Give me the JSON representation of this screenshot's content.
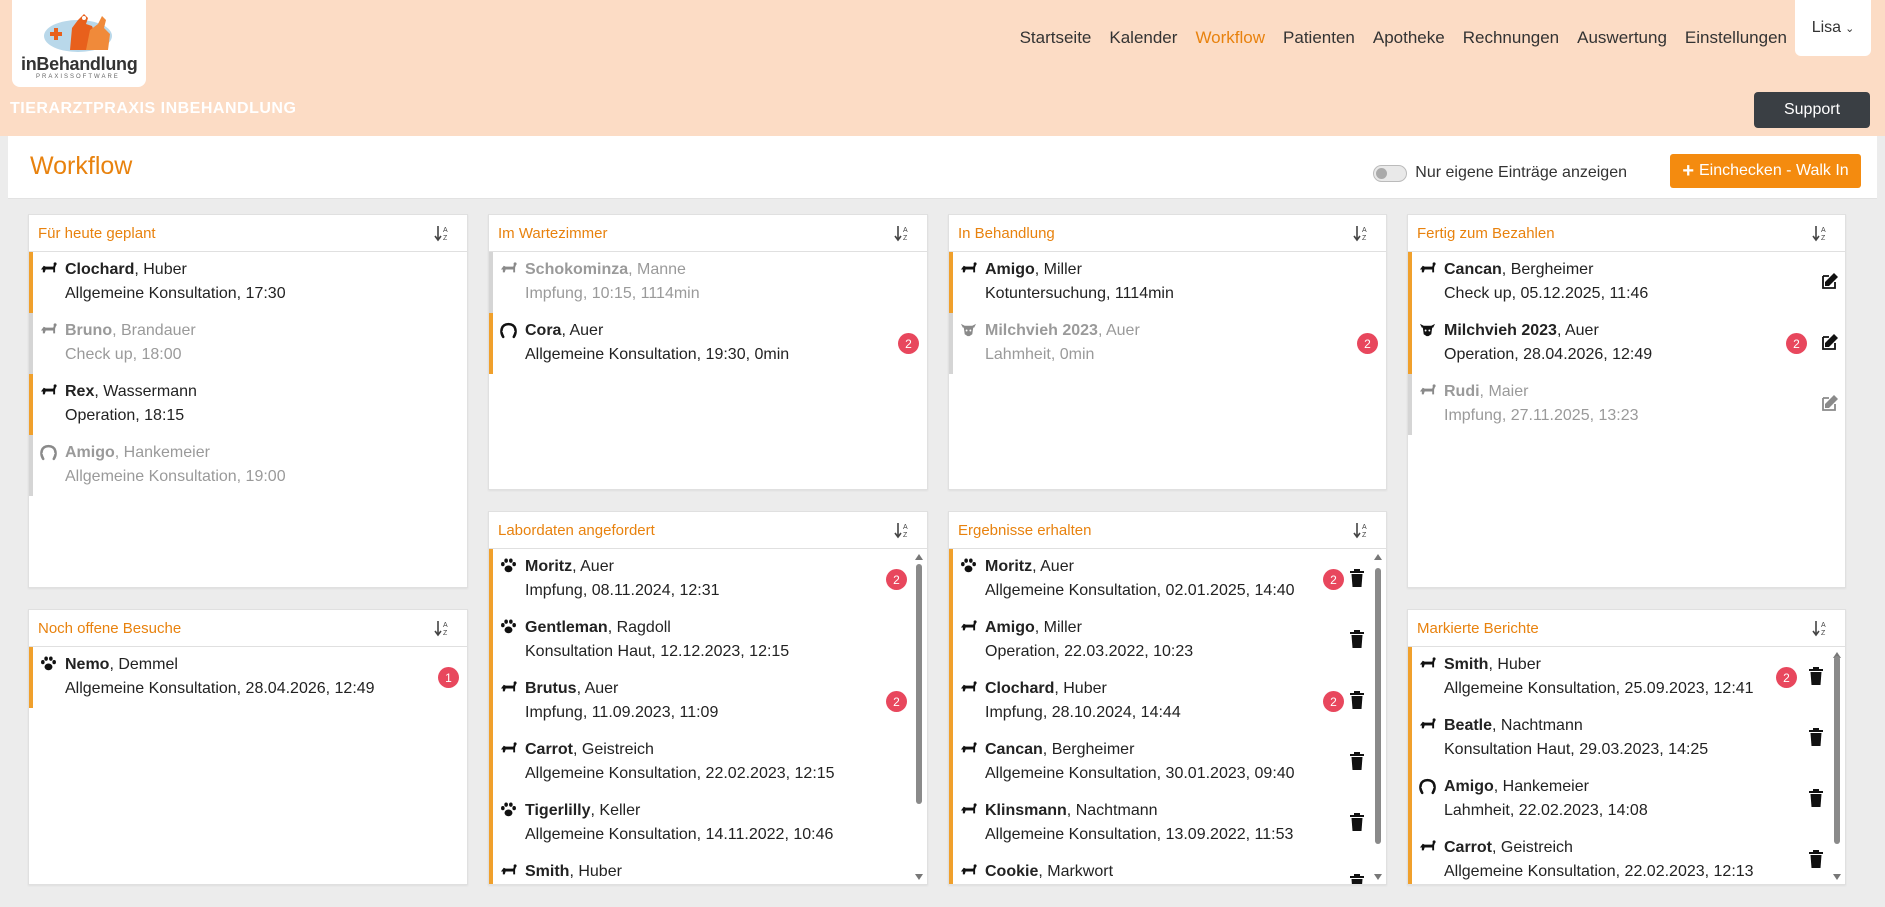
{
  "app": {
    "logo_text_in": "in",
    "logo_text_rest": "Behandlung",
    "logo_sub": "PRAXISSOFTWARE",
    "practice_name": "TIERARZTPRAXIS INBEHANDLUNG",
    "support_label": "Support",
    "user_name": "Lisa"
  },
  "nav": [
    {
      "label": "Startseite",
      "active": false
    },
    {
      "label": "Kalender",
      "active": false
    },
    {
      "label": "Workflow",
      "active": true
    },
    {
      "label": "Patienten",
      "active": false
    },
    {
      "label": "Apotheke",
      "active": false
    },
    {
      "label": "Rechnungen",
      "active": false
    },
    {
      "label": "Auswertung",
      "active": false
    },
    {
      "label": "Einstellungen",
      "active": false
    }
  ],
  "page": {
    "title": "Workflow",
    "toggle_label": "Nur eigene Einträge anzeigen",
    "toggle_on": false,
    "checkin_label": "Einchecken - Walk In"
  },
  "colors": {
    "accent": "#ee7e1a",
    "header_bg": "#fcdcc5",
    "badge": "#e8475d",
    "active_border": "#f0a02c",
    "inactive_border": "#d5d5d5"
  },
  "panels": {
    "geplant": {
      "title": "Für heute geplant",
      "entries": [
        {
          "name": "Clochard",
          "owner": "Huber",
          "detail": "Allgemeine Konsultation, 17:30",
          "icon": "dog-bone-icon",
          "active": true
        },
        {
          "name": "Bruno",
          "owner": "Brandauer",
          "detail": "Check up, 18:00",
          "icon": "dog-bone-icon",
          "active": false
        },
        {
          "name": "Rex",
          "owner": "Wassermann",
          "detail": "Operation, 18:15",
          "icon": "dog-bone-icon",
          "active": true
        },
        {
          "name": "Amigo",
          "owner": "Hankemeier",
          "detail": "Allgemeine Konsultation, 19:00",
          "icon": "horseshoe-icon",
          "active": false
        }
      ]
    },
    "wartezimmer": {
      "title": "Im Wartezimmer",
      "entries": [
        {
          "name": "Schokominza",
          "owner": "Manne",
          "detail": "Impfung, 10:15, 1114min",
          "icon": "dog-bone-icon",
          "active": false
        },
        {
          "name": "Cora",
          "owner": "Auer",
          "detail": "Allgemeine Konsultation, 19:30, 0min",
          "icon": "horseshoe-icon",
          "active": true,
          "badge": "2"
        }
      ]
    },
    "behandlung": {
      "title": "In Behandlung",
      "entries": [
        {
          "name": "Amigo",
          "owner": "Miller",
          "detail": "Kotuntersuchung, 1114min",
          "icon": "dog-bone-icon",
          "active": true
        },
        {
          "name": "Milchvieh 2023",
          "owner": "Auer",
          "detail": "Lahmheit, 0min",
          "icon": "cow-icon",
          "active": false,
          "badge": "2"
        }
      ]
    },
    "bezahlen": {
      "title": "Fertig zum Bezahlen",
      "entries": [
        {
          "name": "Cancan",
          "owner": "Bergheimer",
          "detail": "Check up, 05.12.2025, 11:46",
          "icon": "dog-bone-icon",
          "active": true
        },
        {
          "name": "Milchvieh 2023",
          "owner": "Auer",
          "detail": "Operation, 28.04.2026, 12:49",
          "icon": "cow-icon",
          "active": true,
          "badge": "2"
        },
        {
          "name": "Rudi",
          "owner": "Maier",
          "detail": "Impfung, 27.11.2025, 13:23",
          "icon": "dog-bone-icon",
          "active": false
        }
      ]
    },
    "besuche": {
      "title": "Noch offene Besuche",
      "entries": [
        {
          "name": "Nemo",
          "owner": "Demmel",
          "detail": "Allgemeine Konsultation, 28.04.2026, 12:49",
          "icon": "paw-icon",
          "active": true,
          "badge": "1"
        }
      ]
    },
    "labor": {
      "title": "Labordaten angefordert",
      "entries": [
        {
          "name": "Moritz",
          "owner": "Auer",
          "detail": "Impfung, 08.11.2024, 12:31",
          "icon": "paw-icon",
          "active": true,
          "badge": "2"
        },
        {
          "name": "Gentleman",
          "owner": "Ragdoll",
          "detail": "Konsultation Haut, 12.12.2023, 12:15",
          "icon": "paw-icon",
          "active": true
        },
        {
          "name": "Brutus",
          "owner": "Auer",
          "detail": "Impfung, 11.09.2023, 11:09",
          "icon": "dog-bone-icon",
          "active": true,
          "badge": "2"
        },
        {
          "name": "Carrot",
          "owner": "Geistreich",
          "detail": "Allgemeine Konsultation, 22.02.2023, 12:15",
          "icon": "dog-bone-icon",
          "active": true
        },
        {
          "name": "Tigerlilly",
          "owner": "Keller",
          "detail": "Allgemeine Konsultation, 14.11.2022, 10:46",
          "icon": "paw-icon",
          "active": true
        },
        {
          "name": "Smith",
          "owner": "Huber",
          "detail": "",
          "icon": "dog-bone-icon",
          "active": true
        }
      ]
    },
    "ergebnisse": {
      "title": "Ergebnisse erhalten",
      "entries": [
        {
          "name": "Moritz",
          "owner": "Auer",
          "detail": "Allgemeine Konsultation, 02.01.2025, 14:40",
          "icon": "paw-icon",
          "active": true,
          "badge": "2"
        },
        {
          "name": "Amigo",
          "owner": "Miller",
          "detail": "Operation, 22.03.2022, 10:23",
          "icon": "dog-bone-icon",
          "active": true
        },
        {
          "name": "Clochard",
          "owner": "Huber",
          "detail": "Impfung, 28.10.2024, 14:44",
          "icon": "dog-bone-icon",
          "active": true,
          "badge": "2"
        },
        {
          "name": "Cancan",
          "owner": "Bergheimer",
          "detail": "Allgemeine Konsultation, 30.01.2023, 09:40",
          "icon": "dog-bone-icon",
          "active": true
        },
        {
          "name": "Klinsmann",
          "owner": "Nachtmann",
          "detail": "Allgemeine Konsultation, 13.09.2022, 11:53",
          "icon": "dog-bone-icon",
          "active": true
        },
        {
          "name": "Cookie",
          "owner": "Markwort",
          "detail": "",
          "icon": "dog-bone-icon",
          "active": true
        }
      ]
    },
    "berichte": {
      "title": "Markierte Berichte",
      "entries": [
        {
          "name": "Smith",
          "owner": "Huber",
          "detail": "Allgemeine Konsultation, 25.09.2023, 12:41",
          "icon": "dog-bone-icon",
          "active": true,
          "badge": "2"
        },
        {
          "name": "Beatle",
          "owner": "Nachtmann",
          "detail": "Konsultation Haut, 29.03.2023, 14:25",
          "icon": "dog-bone-icon",
          "active": true
        },
        {
          "name": "Amigo",
          "owner": "Hankemeier",
          "detail": "Lahmheit, 22.02.2023, 14:08",
          "icon": "horseshoe-icon",
          "active": true
        },
        {
          "name": "Carrot",
          "owner": "Geistreich",
          "detail": "Allgemeine Konsultation, 22.02.2023, 12:13",
          "icon": "dog-bone-icon",
          "active": true
        }
      ]
    }
  }
}
